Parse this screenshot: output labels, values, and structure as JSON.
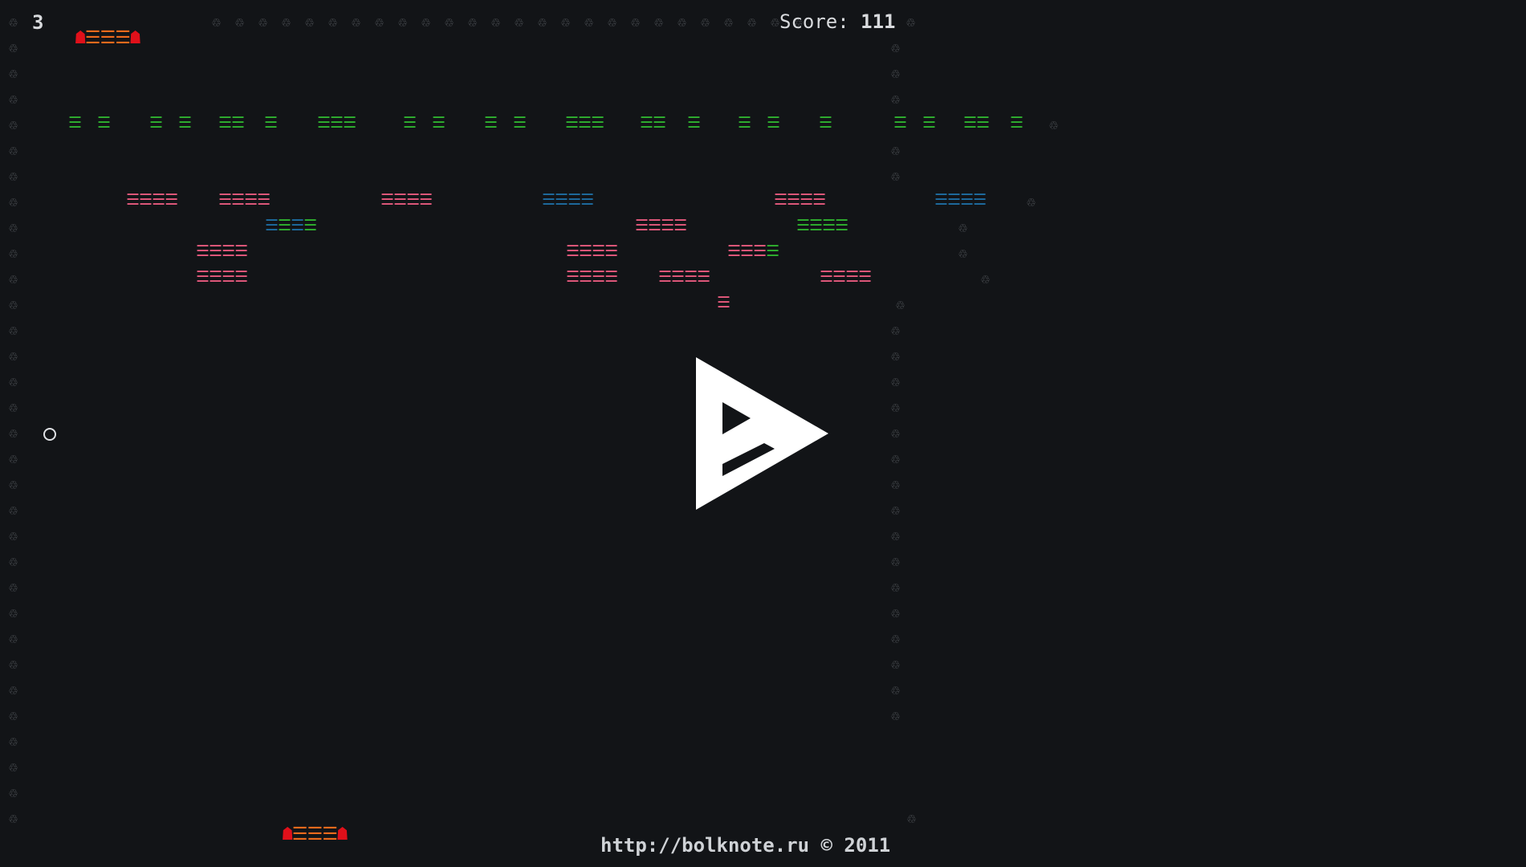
{
  "hud": {
    "lives": "3",
    "score_label": "Score:",
    "score_value": "111"
  },
  "footer": {
    "text": "http://bolknote.ru © 2011"
  },
  "glyphs": {
    "wall": "♲",
    "brick": "☰",
    "paddle_end": "☗",
    "ball": "○"
  },
  "colors": {
    "background": "#121417",
    "wall": "#5d6166",
    "green": "#2fb32f",
    "pink": "#e85a7e",
    "blue": "#1e6ea3",
    "paddle_end": "#e0101a",
    "paddle_mid": "#ee6a1c",
    "text": "#cfd2d6"
  },
  "paddles": {
    "lives_indicator": "☗☰☰☰☗",
    "player": "☗☰☰☰☗"
  },
  "ball": "○",
  "play_icon": "play-icon"
}
